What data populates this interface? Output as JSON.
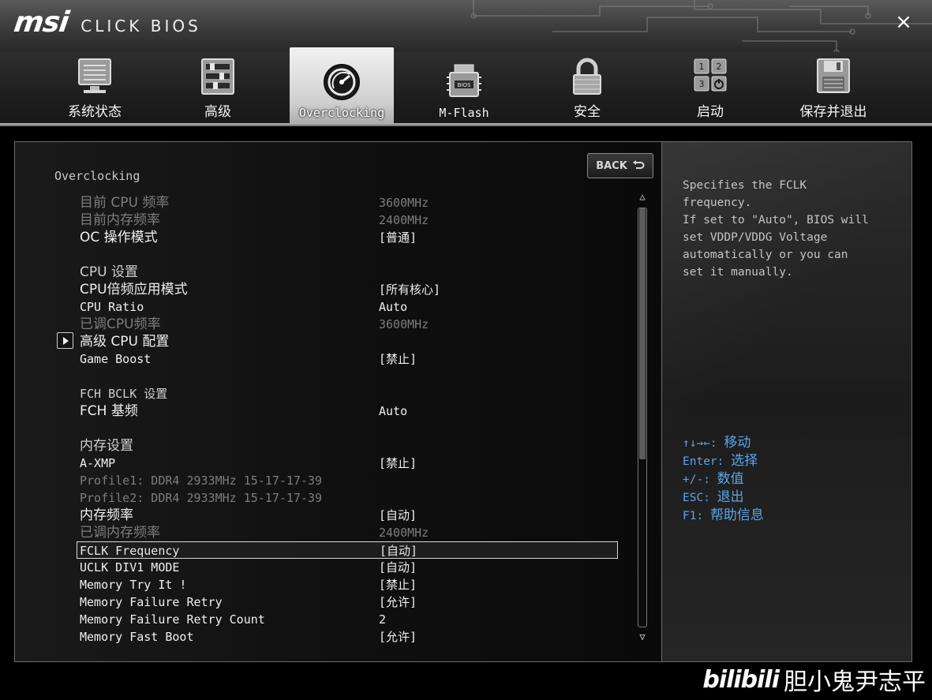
{
  "header": {
    "brand": "msi",
    "product": "CLICK BIOS",
    "close_glyph": "×"
  },
  "tabs": [
    {
      "label": "系统状态",
      "icon": "monitor-icon",
      "active": false
    },
    {
      "label": "高级",
      "icon": "settings-sliders-icon",
      "active": false
    },
    {
      "label": "Overclocking",
      "icon": "speedometer-icon",
      "active": true
    },
    {
      "label": "M-Flash",
      "icon": "bios-chip-icon",
      "active": false
    },
    {
      "label": "安全",
      "icon": "padlock-icon",
      "active": false
    },
    {
      "label": "启动",
      "icon": "boot-keys-icon",
      "active": false
    },
    {
      "label": "保存并退出",
      "icon": "floppy-disk-icon",
      "active": false
    }
  ],
  "main": {
    "back_label": "BACK",
    "section_title": "Overclocking",
    "rows": [
      {
        "key": "目前 CPU 频率",
        "value": "3600MHz",
        "style": "dim"
      },
      {
        "key": "目前内存频率",
        "value": "2400MHz",
        "style": "dim"
      },
      {
        "key": "OC 操作模式",
        "value": "[普通]",
        "style": "bright"
      },
      {
        "key": "CPU 设置",
        "value": "",
        "style": "head"
      },
      {
        "key": "CPU倍频应用模式",
        "value": "[所有核心]",
        "style": "bright"
      },
      {
        "key": "CPU Ratio",
        "value": "Auto",
        "style": "bright"
      },
      {
        "key": "已调CPU频率",
        "value": "3600MHz",
        "style": "dim"
      },
      {
        "key": "高级 CPU 配置",
        "value": "",
        "style": "bright"
      },
      {
        "key": "Game Boost",
        "value": "[禁止]",
        "style": "bright"
      },
      {
        "key": "FCH BCLK 设置",
        "value": "",
        "style": "head"
      },
      {
        "key": "FCH 基频",
        "value": "Auto",
        "style": "bright"
      },
      {
        "key": "内存设置",
        "value": "",
        "style": "head"
      },
      {
        "key": "A-XMP",
        "value": "[禁止]",
        "style": "bright"
      },
      {
        "key": "Profile1: DDR4 2933MHz 15-17-17-39",
        "value": "",
        "style": "dim"
      },
      {
        "key": "Profile2: DDR4 2933MHz 15-17-17-39",
        "value": "",
        "style": "dim"
      },
      {
        "key": "内存频率",
        "value": "[自动]",
        "style": "bright"
      },
      {
        "key": "已调内存频率",
        "value": "2400MHz",
        "style": "dim"
      },
      {
        "key": "FCLK Frequency",
        "value": "[自动]",
        "style": "selected"
      },
      {
        "key": "UCLK DIV1 MODE",
        "value": "[自动]",
        "style": "bright"
      },
      {
        "key": "Memory Try It !",
        "value": "[禁止]",
        "style": "bright"
      },
      {
        "key": "Memory Failure Retry",
        "value": "[允许]",
        "style": "bright"
      },
      {
        "key": "Memory Failure Retry Count",
        "value": "2",
        "style": "bright"
      },
      {
        "key": "Memory Fast Boot",
        "value": "[允许]",
        "style": "bright"
      }
    ],
    "scroll_position": 0.0,
    "scroll_visible_fraction": 0.6
  },
  "help": {
    "description": "Specifies the FCLK\nfrequency.\nIf set to \"Auto\", BIOS will\nset VDDP/VDDG Voltage\nautomatically or you can\nset it manually.",
    "keys": [
      {
        "key": "↑↓→←:",
        "action": "移动"
      },
      {
        "key": "Enter:",
        "action": "选择"
      },
      {
        "key": "+/-:",
        "action": "数值"
      },
      {
        "key": "ESC:",
        "action": "退出"
      },
      {
        "key": "F1:",
        "action": "帮助信息"
      }
    ]
  },
  "watermark": {
    "logo": "bilibili",
    "name": "胆小鬼尹志平"
  },
  "colors": {
    "help_key": "#5aa5ea",
    "dim_text": "#7d7d7d",
    "bright_text": "#f0f0f0"
  }
}
